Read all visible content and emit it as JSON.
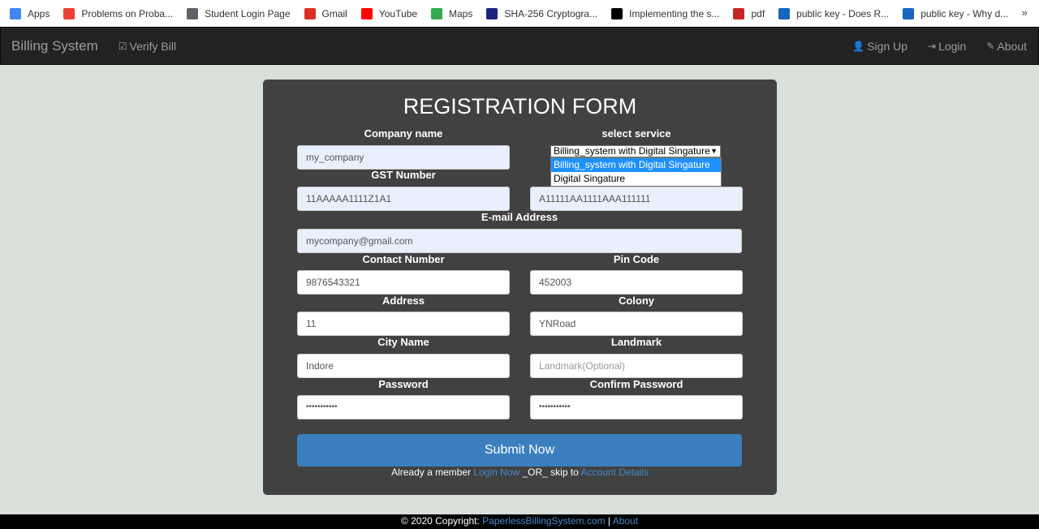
{
  "bookmarks": {
    "items": [
      {
        "label": "Apps",
        "icon": "apps-grid-icon",
        "color": "#4285f4"
      },
      {
        "label": "Problems on Proba...",
        "icon": "problems-icon",
        "color": "#e94235"
      },
      {
        "label": "Student Login Page",
        "icon": "globe-icon",
        "color": "#5f6368"
      },
      {
        "label": "Gmail",
        "icon": "gmail-icon",
        "color": "#d93025"
      },
      {
        "label": "YouTube",
        "icon": "youtube-icon",
        "color": "#ff0000"
      },
      {
        "label": "Maps",
        "icon": "maps-icon",
        "color": "#34a853"
      },
      {
        "label": "SHA-256 Cryptogra...",
        "icon": "sha-icon",
        "color": "#1a237e"
      },
      {
        "label": "Implementing the s...",
        "icon": "medium-icon",
        "color": "#000000"
      },
      {
        "label": "pdf",
        "icon": "iop-icon",
        "color": "#c62828"
      },
      {
        "label": "public key - Does R...",
        "icon": "stackexchange-icon",
        "color": "#1565c0"
      },
      {
        "label": "public key - Why d...",
        "icon": "stackexchange-icon",
        "color": "#1565c0"
      }
    ],
    "more": "»"
  },
  "navbar": {
    "brand": "Billing System",
    "verify": "Verify Bill",
    "signup": "Sign Up",
    "login": "Login",
    "about": "About"
  },
  "form": {
    "title": "REGISTRATION FORM",
    "company_label": "Company name",
    "company_value": "my_company",
    "service_label": "select service",
    "service_selected": "Billing_system with Digital Singature",
    "service_options": [
      "Billing_system with Digital Singature",
      "Digital Singature"
    ],
    "gst_label": "GST Number",
    "gst_value": "11AAAAA1111Z1A1",
    "pan_value": "A11111AA1111AAA111111",
    "email_label": "E-mail Address",
    "email_value": "mycompany@gmail.com",
    "contact_label": "Contact Number",
    "contact_value": "9876543321",
    "pin_label": "Pin Code",
    "pin_value": "452003",
    "address_label": "Address",
    "address_value": "11",
    "colony_label": "Colony",
    "colony_value": "YNRoad",
    "city_label": "City Name",
    "city_value": "Indore",
    "landmark_label": "Landmark",
    "landmark_placeholder": "Landmark(Optional)",
    "password_label": "Password",
    "password_value": "•••••••••••",
    "confirm_label": "Confirm Password",
    "confirm_value": "•••••••••••",
    "submit": "Submit Now",
    "already_text": "Already a member ",
    "login_link": "Login Now",
    "or_text": " _OR_ skip to ",
    "account_link": "Account Details"
  },
  "footer": {
    "copyright": "© 2020 Copyright: ",
    "site_link": "PaperlessBillingSystem.com",
    "sep": " | ",
    "about_link": "About"
  }
}
